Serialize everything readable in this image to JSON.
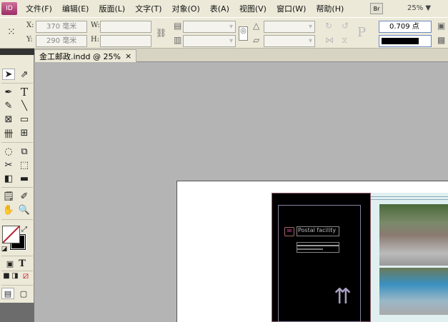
{
  "app": {
    "logo": "ID",
    "bridge": "Br",
    "zoom": "25% ▼"
  },
  "menu": [
    "文件(F)",
    "编辑(E)",
    "版面(L)",
    "文字(T)",
    "对象(O)",
    "表(A)",
    "视图(V)",
    "窗口(W)",
    "帮助(H)"
  ],
  "control": {
    "x_label": "X:",
    "x_value": "370 毫米",
    "y_label": "Y:",
    "y_value": "290 毫米",
    "w_label": "W:",
    "h_label": "H:",
    "stroke_weight": "0.709 点"
  },
  "tab": {
    "title": "金工邮政.indd @ 25%",
    "close": "×"
  },
  "artwork": {
    "heading": "Postal facility"
  },
  "colors": {
    "canvas": "#b4b4b4",
    "panel": "#ece9d8",
    "accent": "#9a2c66"
  }
}
